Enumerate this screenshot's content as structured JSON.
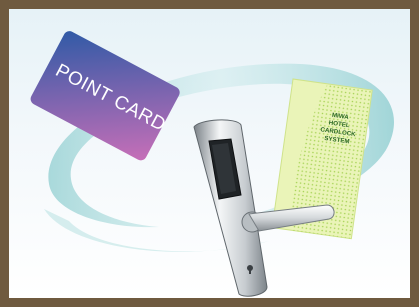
{
  "point_card": {
    "label": "POINT CARD",
    "colors": {
      "start": "#2f5aa6",
      "end": "#c86fb8"
    }
  },
  "green_card": {
    "lines": [
      "MIWA",
      "HOTEL",
      "CARDLOCK",
      "SYSTEM"
    ],
    "colors": {
      "base": "#eaf4b8",
      "dots": "#9fcf4a",
      "text": "#2f6a2a"
    }
  },
  "colors": {
    "frame": "#6f5a3f",
    "background_top": "#e6f2f7",
    "swoosh": "#7fc7c9"
  },
  "icons": [
    "door-lock-handle-icon",
    "keyhole-icon",
    "swoosh-ring-icon"
  ]
}
